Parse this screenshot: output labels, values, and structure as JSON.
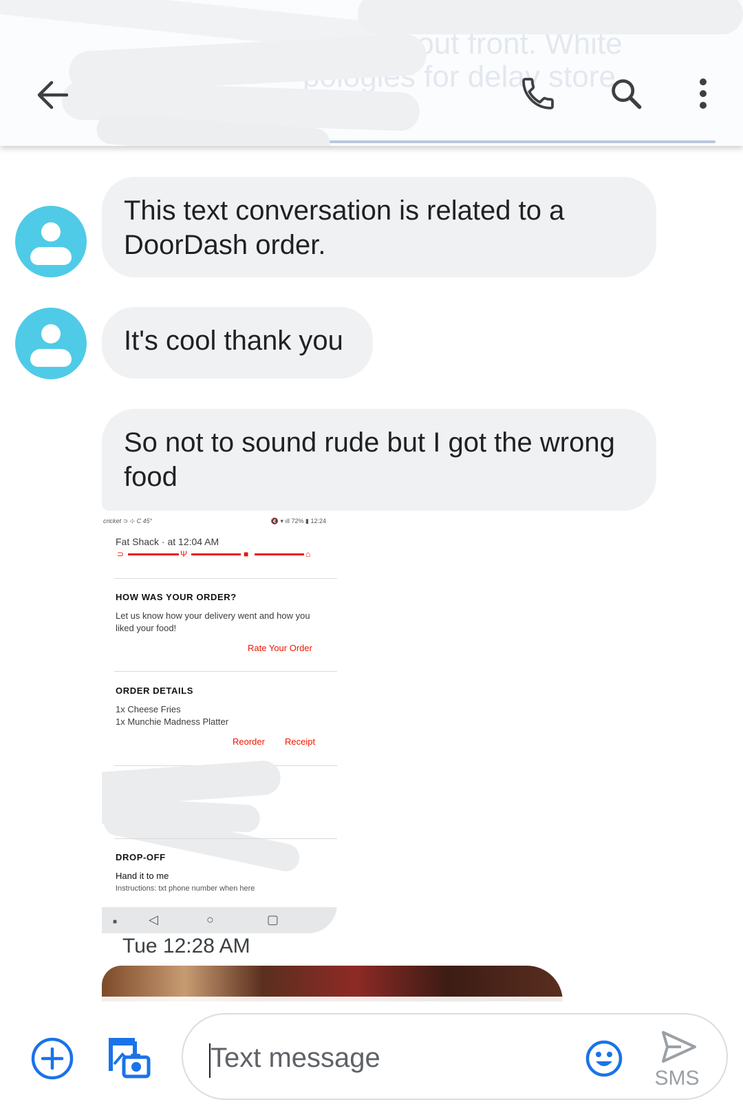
{
  "header": {
    "contact_name": "",
    "background_text": "ght now out front. White\npologies for delay store\nder.",
    "icons": {
      "back": "back-arrow-icon",
      "call": "phone-icon",
      "search": "search-icon",
      "more": "more-vert-icon"
    }
  },
  "messages": [
    {
      "text": "This text conversation is related to a DoorDash order."
    },
    {
      "text": "It's cool thank you"
    },
    {
      "text": "So not to sound rude but I got the wrong food"
    }
  ],
  "attachment": {
    "status_left": "cricket ⊃ ⊹ C 45°",
    "status_right": "🔇 ▾ ıll 72% ▮ 12:24",
    "store_line": "Fat Shack · at 12:04 AM",
    "rate": {
      "heading": "HOW WAS YOUR ORDER?",
      "body": "Let us know how your delivery went and how you liked your food!",
      "link": "Rate Your Order"
    },
    "order": {
      "heading": "ORDER DETAILS",
      "items": [
        "1x Cheese Fries",
        "1x Munchie Madness Platter"
      ],
      "reorder": "Reorder",
      "receipt": "Receipt"
    },
    "dropoff": {
      "heading": "DROP-OFF",
      "option": "Hand it to me",
      "instructions": "Instructions: txt phone number when here"
    }
  },
  "timestamp": "Tue 12:28 AM",
  "compose": {
    "placeholder": "Text message",
    "send_label": "SMS"
  },
  "colors": {
    "avatar": "#4fcbe7",
    "bubble": "#f0f1f3",
    "accent_blue": "#1a73e8",
    "doordash_red": "#eb1700"
  }
}
